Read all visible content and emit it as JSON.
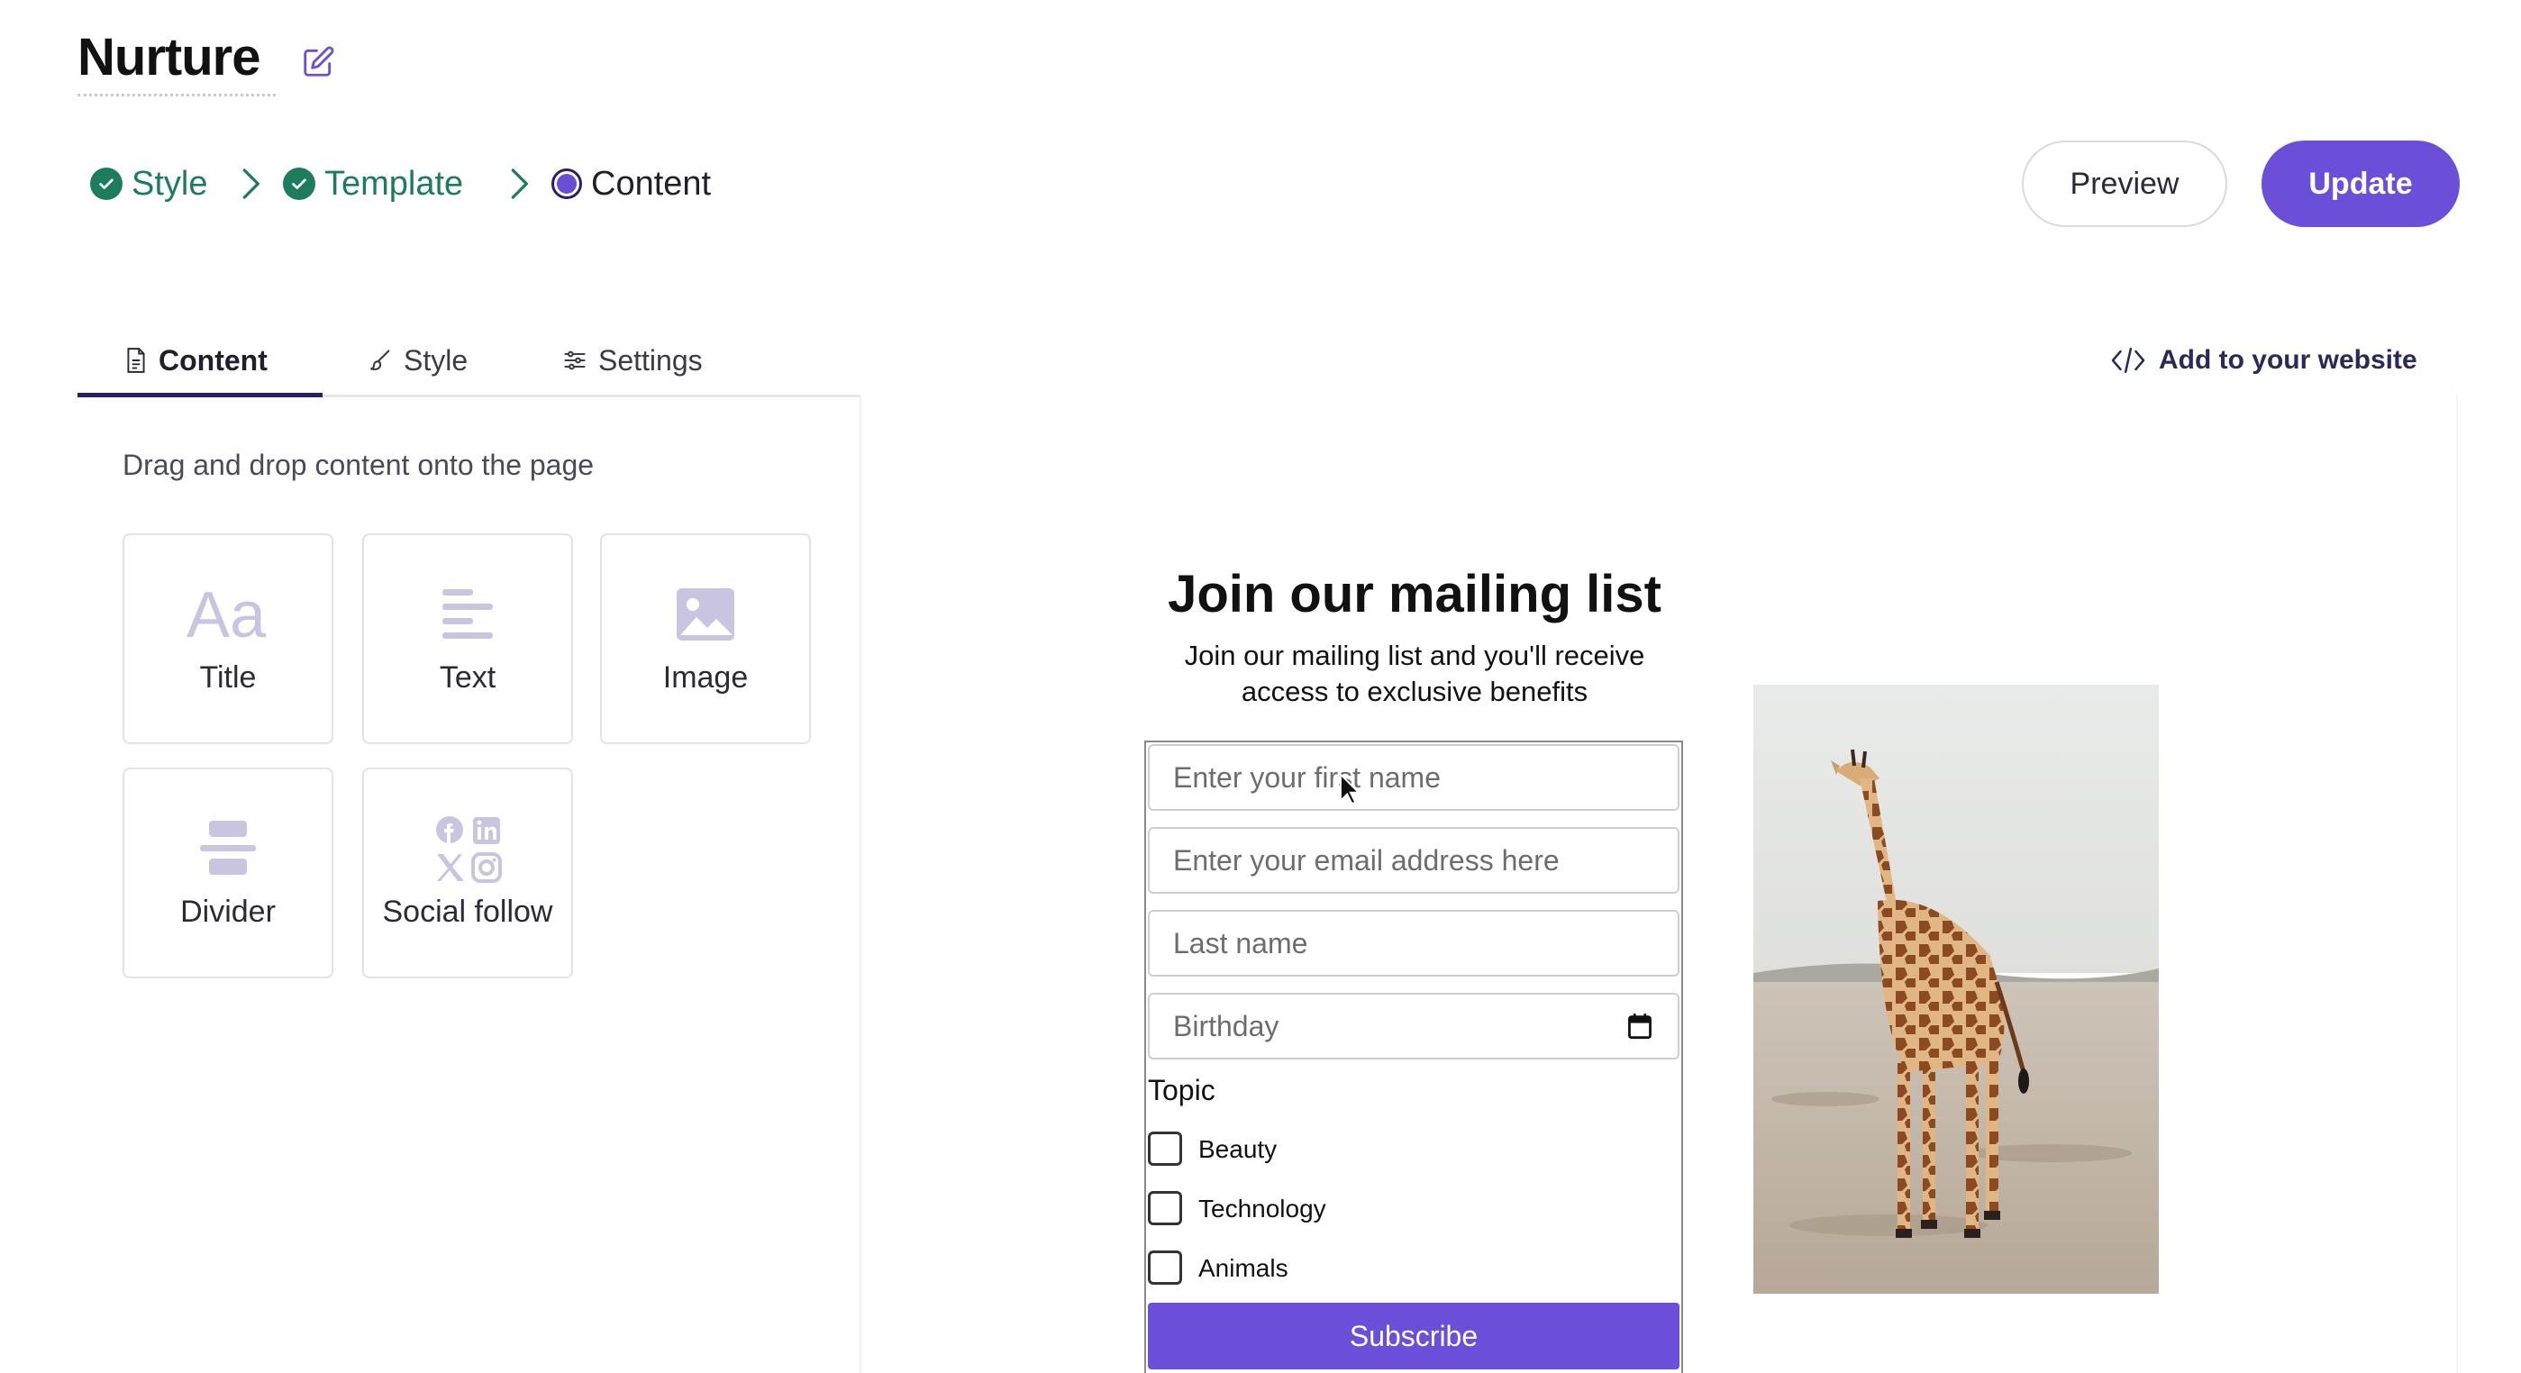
{
  "page": {
    "title": "Nurture"
  },
  "steps": [
    {
      "label": "Style",
      "state": "done"
    },
    {
      "label": "Template",
      "state": "done"
    },
    {
      "label": "Content",
      "state": "current"
    }
  ],
  "actions": {
    "preview_label": "Preview",
    "update_label": "Update"
  },
  "tabs": [
    {
      "label": "Content",
      "icon": "document-icon",
      "active": true
    },
    {
      "label": "Style",
      "icon": "brush-icon",
      "active": false
    },
    {
      "label": "Settings",
      "icon": "sliders-icon",
      "active": false
    }
  ],
  "add_to_website": {
    "label": "Add to your website",
    "icon": "code-icon"
  },
  "sidebar": {
    "hint": "Drag and drop content onto the page",
    "blocks": [
      {
        "label": "Title",
        "icon": "font-icon"
      },
      {
        "label": "Text",
        "icon": "text-lines-icon"
      },
      {
        "label": "Image",
        "icon": "image-icon"
      },
      {
        "label": "Divider",
        "icon": "divider-icon"
      },
      {
        "label": "Social follow",
        "icon": "social-icons"
      }
    ]
  },
  "form": {
    "title": "Join our mailing list",
    "subtitle_line1": "Join our mailing list and you'll receive",
    "subtitle_line2": "access to exclusive benefits",
    "fields": {
      "first_name_placeholder": "Enter your first name",
      "email_placeholder": "Enter your email address here",
      "last_name_placeholder": "Last name",
      "birthday_placeholder": "Birthday"
    },
    "topic_label": "Topic",
    "topics": [
      "Beauty",
      "Technology",
      "Animals"
    ],
    "submit_label": "Subscribe"
  },
  "colors": {
    "accent": "#6c4fd8",
    "step_done": "#1d7c5c",
    "active_tab": "#2a1f66"
  }
}
